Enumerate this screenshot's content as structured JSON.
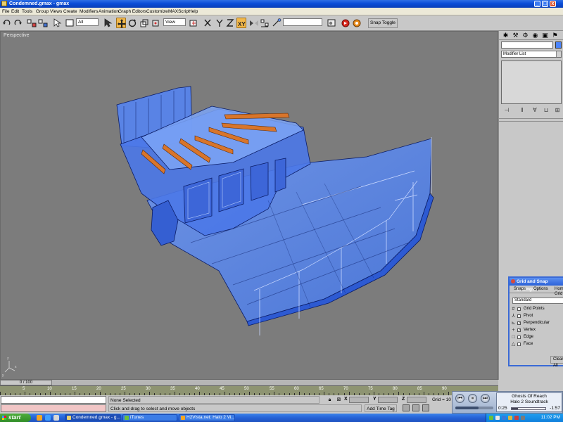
{
  "window": {
    "title": "Condemned.gmax - gmax",
    "min": "_",
    "max": "□",
    "close": "x"
  },
  "menu": [
    "File",
    "Edit",
    "Tools",
    "Group",
    "Views",
    "Create",
    "Modifiers",
    "Animation",
    "Graph Editors",
    "Customize",
    "MAXScript",
    "Help"
  ],
  "toolbar": {
    "selection_filter": "All",
    "reference_coord": "View",
    "named_selection": "",
    "snap_toggle": "Snap Toggle",
    "active_tool": "select-and-move"
  },
  "viewport": {
    "label": "Perspective",
    "background": "#7c7c7c",
    "mesh_fill": "#5f8df0",
    "mesh_edge": "#0a1c66",
    "rail_color": "#e07a2a"
  },
  "command_panel": {
    "tab_icons": [
      "create-icon",
      "modify-icon",
      "hierarchy-icon",
      "motion-icon",
      "display-icon",
      "utilities-icon"
    ],
    "modifier_list": "Modifier List",
    "object_color": "#4a84ff"
  },
  "snap_dialog": {
    "title": "Grid and Snap Settings",
    "tabs": [
      "Snaps",
      "Options",
      "Home Grid"
    ],
    "preset": "Standard",
    "items": [
      {
        "label": "Grid Points",
        "checked": false,
        "icon": "#"
      },
      {
        "label": "Pivot",
        "checked": false,
        "icon": "⅄"
      },
      {
        "label": "Perpendicular",
        "checked": true,
        "icon": "⊾"
      },
      {
        "label": "Vertex",
        "checked": true,
        "icon": "+"
      },
      {
        "label": "Edge",
        "checked": false,
        "icon": "□"
      },
      {
        "label": "Face",
        "checked": false,
        "icon": "△"
      }
    ],
    "clear_all": "Clear All"
  },
  "timeline": {
    "frame_display": "0 / 100",
    "ticks": [
      "5",
      "10",
      "15",
      "20",
      "25",
      "30",
      "35",
      "40",
      "45",
      "50",
      "55",
      "60",
      "65",
      "70",
      "75",
      "80",
      "85",
      "90"
    ]
  },
  "status": {
    "selection": "None Selected",
    "prompt": "Click and drag to select and move objects",
    "x_label": "X",
    "y_label": "Y",
    "z_label": "Z",
    "grid": "Grid = 10",
    "add_time_tag": "Add Time Tag"
  },
  "media_player": {
    "song": "Ghosts Of Reach",
    "album": "Halo 2 Soundtrack",
    "elapsed": "0:25",
    "remaining": "-1:57",
    "progress": 0.18,
    "volume": 0.62
  },
  "taskbar": {
    "start": "start",
    "tasks": [
      {
        "label": "Condemned.gmax - g...",
        "active": true
      },
      {
        "label": "iTunes",
        "active": false
      },
      {
        "label": "H2Vista.net: Halo 2 Vi...",
        "active": false
      }
    ],
    "clock": "11:02 PM"
  }
}
